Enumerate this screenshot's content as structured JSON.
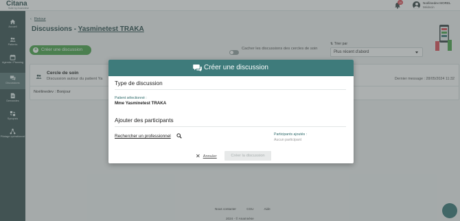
{
  "app": {
    "logo": "Citana",
    "logo_sub": "Suite by Anamnèse"
  },
  "header": {
    "notification_count": "10",
    "user_name": "Noélinedev MOREL",
    "user_role": "Médecin"
  },
  "sidebar": {
    "items": [
      {
        "label": "Accueil",
        "icon": "home-icon"
      },
      {
        "label": "Patients",
        "icon": "patients-icon"
      },
      {
        "label": "Agenda / Planning",
        "icon": "calendar-icon"
      },
      {
        "label": "Discussions",
        "icon": "chat-icon",
        "active": true
      },
      {
        "label": "Demandes",
        "icon": "document-icon"
      },
      {
        "label": "Synopsis",
        "icon": "synopsis-icon"
      },
      {
        "label": "Pilotage opérationnel",
        "icon": "network-icon"
      }
    ]
  },
  "main": {
    "back_label": "Retour",
    "title_prefix": "Discussions - ",
    "patient_name": "Yasminetest TRAKA",
    "create_button": "Créer une discussion",
    "toggle_label": "Cacher les discussions des cercles de soin",
    "sort": {
      "label": "Trier par",
      "selected": "Plus récent d'abord"
    },
    "conversation": {
      "title": "Cercle de soin",
      "subtitle": "Discussion autour du patient Ya",
      "last_message_date": "Dernier message : 28/05/2024 11:32",
      "last_message": "Noélinedev : Bonjour"
    }
  },
  "footer": {
    "links": [
      "Nous contacter",
      "CGU",
      "Aide"
    ],
    "copyright": "2024 - © Anamnèse"
  },
  "modal": {
    "title": "Créer une discussion",
    "type_section": "Type de discussion",
    "selected_patient_label": "Patient sélectionné :",
    "selected_patient_value": "Mme Yasminetest TRAKA",
    "participants_section": "Ajouter des participants",
    "search_professional": "Rechercher un professionnel",
    "added_participants_label": "Participants ajoutés :",
    "no_participant": "Aucun participant",
    "cancel_label": "Annuler",
    "submit_label": "Créer la discussion"
  },
  "colors": {
    "sidebar": "#3e5757",
    "modal_header": "#3e7b7b",
    "create_button": "#4fa64f",
    "badge": "#e0525c"
  }
}
